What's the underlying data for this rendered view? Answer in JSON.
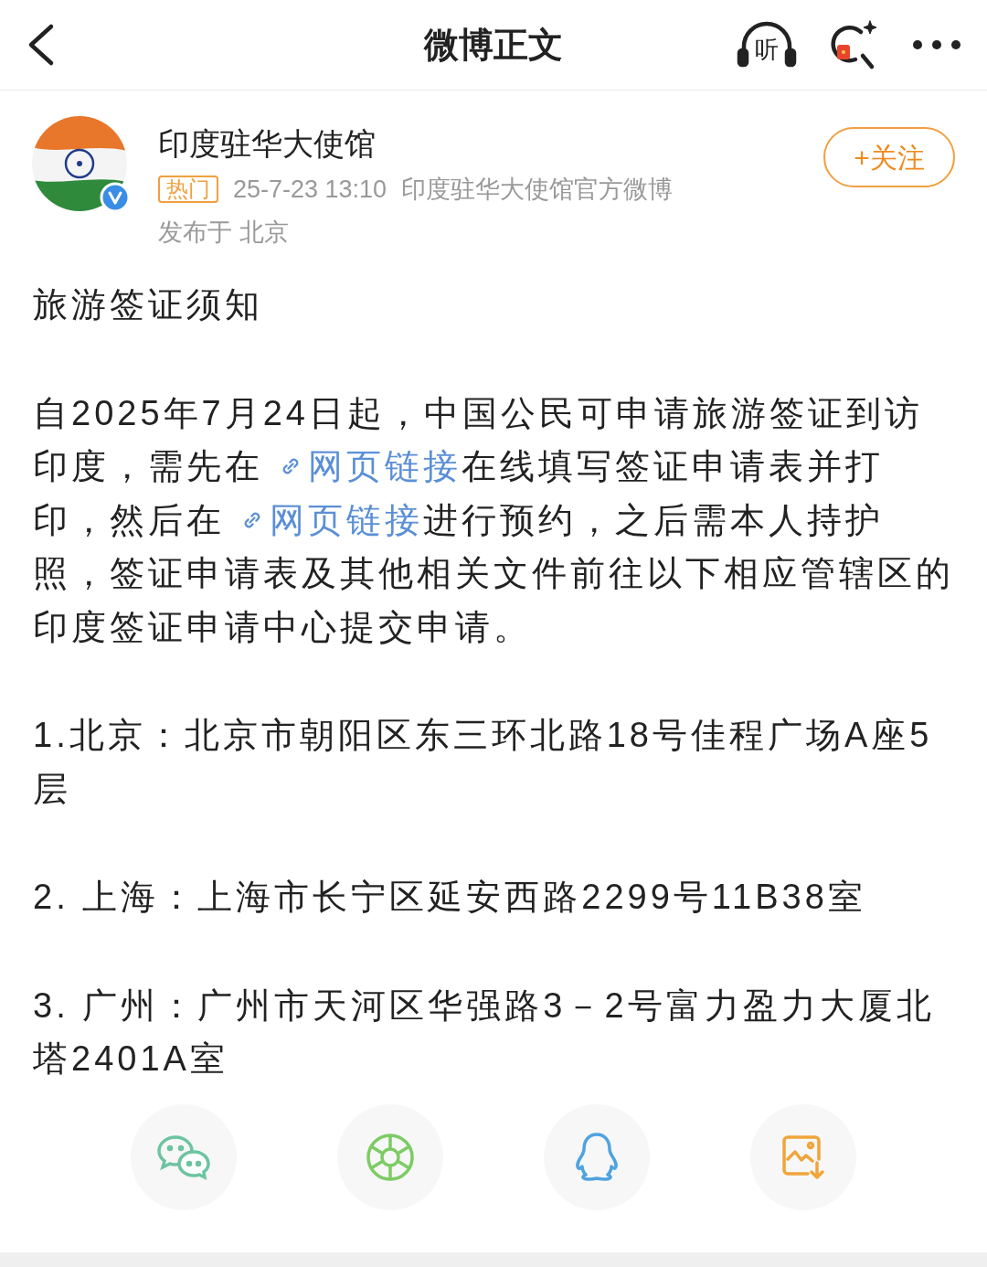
{
  "header": {
    "title": "微博正文",
    "listen_label": "听"
  },
  "author": {
    "name": "印度驻华大使馆",
    "verified": true,
    "badge": "热门",
    "time": "25-7-23 13:10",
    "source": "印度驻华大使馆官方微博",
    "location": "发布于 北京",
    "follow": "+关注"
  },
  "post": {
    "paragraphs": [
      [
        {
          "kind": "text",
          "text": "旅游签证须知"
        }
      ],
      [
        {
          "kind": "text",
          "text": "自2025年7月24日起，中国公民可申请旅游签证到访印度，需先在 "
        },
        {
          "kind": "link",
          "text": "网页链接"
        },
        {
          "kind": "text",
          "text": "在线填写签证申请表并打印，然后在 "
        },
        {
          "kind": "link",
          "text": "网页链接"
        },
        {
          "kind": "text",
          "text": "进行预约，之后需本人持护照，签证申请表及其他相关文件前往以下相应管辖区的印度签证申请中心提交申请。"
        }
      ],
      [
        {
          "kind": "text",
          "text": "1.北京：北京市朝阳区东三环北路18号佳程广场A座5层"
        }
      ],
      [
        {
          "kind": "text",
          "text": "2. 上海：上海市长宁区延安西路2299号11B38室"
        }
      ],
      [
        {
          "kind": "text",
          "text": "3. 广州：广州市天河区华强路3－2号富力盈力大厦北塔2401A室"
        }
      ]
    ]
  },
  "share": [
    {
      "kind": "wechat"
    },
    {
      "kind": "moments"
    },
    {
      "kind": "qq"
    },
    {
      "kind": "save-image"
    }
  ]
}
